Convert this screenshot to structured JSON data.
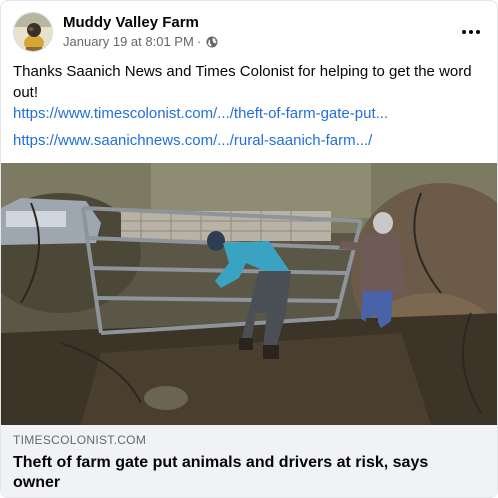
{
  "post": {
    "page_name": "Muddy Valley Farm",
    "date": "January 19 at 8:01 PM",
    "separator": "·",
    "privacy_icon": "globe-icon",
    "more_icon": "more-horizontal-icon",
    "body_text": "Thanks Saanich News and Times Colonist for helping to get the word out!",
    "links": [
      "https://www.timescolonist.com/.../theft-of-farm-gate-put...",
      "https://www.saanichnews.com/.../rural-saanich-farm.../"
    ],
    "link_color": "#216fdb"
  },
  "link_preview": {
    "domain": "TIMESCOLONIST.COM",
    "headline": "Theft of farm gate put animals and drivers at risk, says owner",
    "background": "#f0f2f5"
  }
}
